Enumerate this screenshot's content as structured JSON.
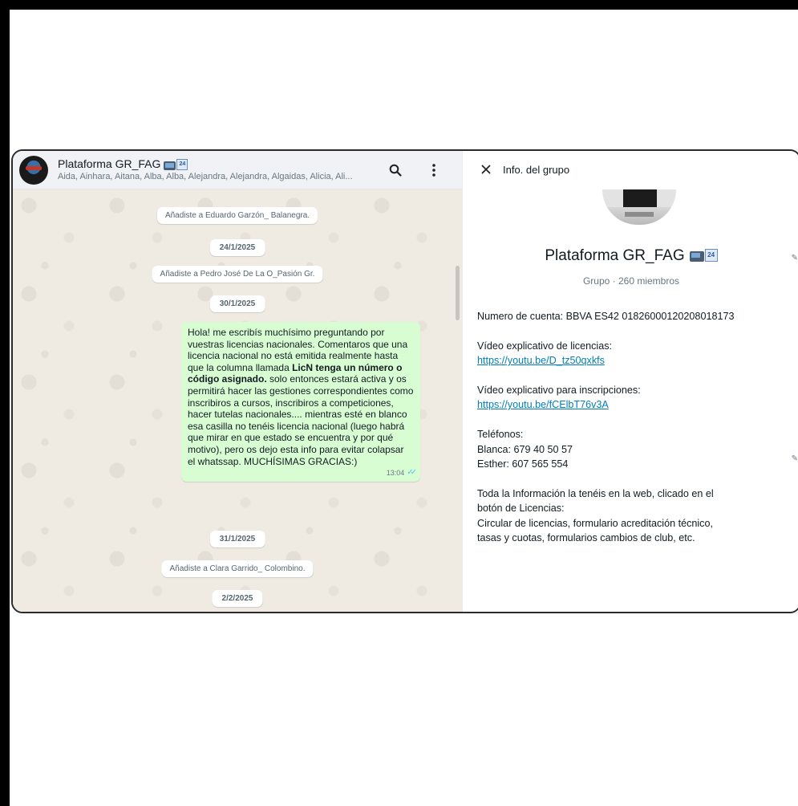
{
  "chat": {
    "title": "Plataforma GR_FAG",
    "members_preview": "Aida, Ainhara, Aitana, Alba, Alba, Alejandra, Alejandra, Algaidas, Alicia, Ali...",
    "icons": [
      "search-icon",
      "menu-icon"
    ],
    "messages": {
      "sys1": "Añadiste a Eduardo Garzón_ Balanegra.",
      "date1": "24/1/2025",
      "sys2": "Añadiste a Pedro José De La O_Pasión Gr.",
      "date2": "30/1/2025",
      "bubble": {
        "part1": "Hola! me escribís muchísimo preguntando por vuestras licencias nacionales. Comentaros que una licencia nacional no está emitida realmente hasta que la columna llamada ",
        "bold": "LicN tenga un número o código asignado.",
        "part2": " solo entonces estará activa y os permitirá hacer las gestiones correspondientes como inscribiros a cursos, inscribiros a competiciones, hacer tutelas nacionales.... mientras esté en blanco esa casilla no tenéis licencia nacional (luego habrá que mirar en que estado se encuentra y por qué motivo), pero os dejo esta info para evitar colapsar el whatssap. MUCHÍSIMAS GRACIAS:)",
        "time": "13:04"
      },
      "date3": "31/1/2025",
      "sys3": "Añadiste a Clara Garrido_ Colombino.",
      "date4": "2/2/2025"
    }
  },
  "info": {
    "header": "Info. del grupo",
    "group_name": "Plataforma GR_FAG",
    "group_meta": "Grupo · 260 miembros",
    "account": "Numero de cuenta: BBVA ES42 01826000120208018173",
    "video1_label": "Vídeo explicativo de licencias:",
    "video1_link": "https://youtu.be/D_tz50qxkfs",
    "video2_label": "Vídeo explicativo para inscripciones:",
    "video2_link": "https://youtu.be/fCElbT76v3A",
    "phones_label": "Teléfonos:",
    "phone1": "Blanca: 679 40 50 57",
    "phone2": "Esther: 607 565 554",
    "info_line1": "Toda la Información la tenéis en la web, clicado en el",
    "info_line2": "botón de Licencias:",
    "info_line3": "Circular de licencias, formulario acreditación técnico,",
    "info_line4": "tasas y cuotas, formularios cambios de club, etc."
  },
  "emoji_calendar_text": "24",
  "colors": {
    "outgoing_bubble": "#d9fdd3",
    "chat_background": "#efeae2",
    "link": "#027eb5",
    "read_ticks": "#53bdeb"
  }
}
